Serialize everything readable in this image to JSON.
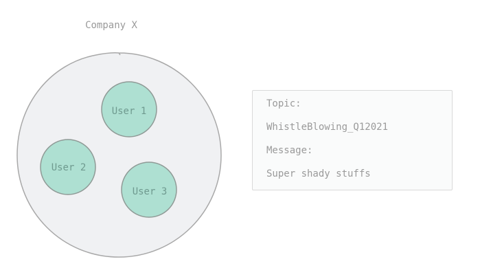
{
  "company": {
    "label": "Company X"
  },
  "users": [
    {
      "label": "User 1"
    },
    {
      "label": "User 2"
    },
    {
      "label": "User 3"
    }
  ],
  "message_panel": {
    "topic_label": "Topic:",
    "topic_value": "WhistleBlowing_Q12021",
    "message_label": "Message:",
    "message_value": "Super shady stuffs"
  },
  "colors": {
    "company_fill": "#f0f1f3",
    "company_stroke": "#a8a8a8",
    "user_fill": "#aee0d2",
    "user_stroke": "#8f9a96",
    "text_muted": "#9a9a9a",
    "user_text": "#6f9a8f"
  }
}
